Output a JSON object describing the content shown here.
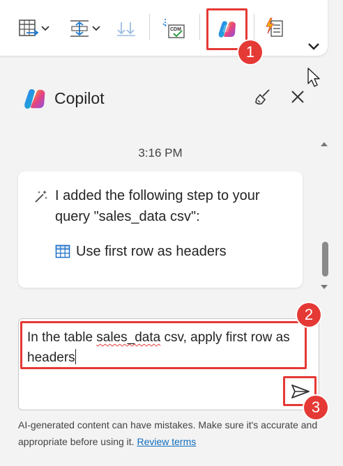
{
  "ribbon": {
    "buttons": [
      {
        "name": "manage-columns",
        "icon": "table-columns-icon"
      },
      {
        "name": "reduce-rows",
        "icon": "reduce-rows-icon"
      },
      {
        "name": "sort",
        "icon": "sort-down-icon"
      },
      {
        "name": "cdm-map",
        "icon": "cdm-icon",
        "icon_text": "CDM"
      },
      {
        "name": "copilot",
        "icon": "copilot-icon"
      },
      {
        "name": "power-query",
        "icon": "lightning-doc-icon"
      }
    ],
    "overflow_icon": "chevron-down-icon"
  },
  "steps": {
    "one": "1",
    "two": "2",
    "three": "3"
  },
  "pane": {
    "title": "Copilot",
    "clear_icon": "broom-icon",
    "close_icon": "close-icon"
  },
  "chat": {
    "timestamp": "3:16 PM",
    "message": {
      "line1": "I added the following step to your",
      "line2": "query \"sales_data csv\":",
      "step_label": "Use first row as headers"
    }
  },
  "composer": {
    "text_before": "In the table ",
    "text_squiggle": "sales_data",
    "text_after": " csv, apply first row as headers",
    "send_icon": "send-icon"
  },
  "disclaimer": {
    "text": "AI-generated content can have mistakes. Make sure it's accurate and appropriate before using it. ",
    "link": "Review terms"
  },
  "colors": {
    "highlight": "#e53935",
    "link": "#0f6cbd",
    "panel_bg": "#f3f3f3"
  }
}
